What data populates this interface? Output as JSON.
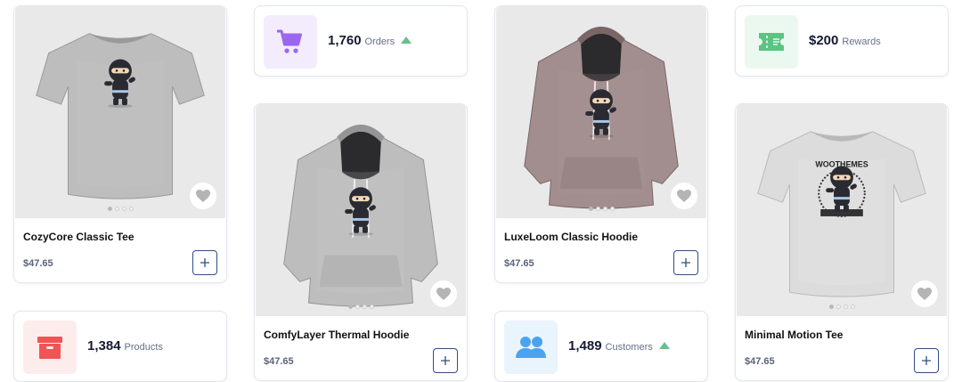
{
  "products": [
    {
      "name": "CozyCore Classic Tee",
      "price": "$47.65",
      "type": "tee",
      "color": "#bdbdbd",
      "dots": 4
    },
    {
      "name": "ComfyLayer Thermal Hoodie",
      "price": "$47.65",
      "type": "hoodie",
      "color": "#bdbdbd",
      "dots": 4
    },
    {
      "name": "LuxeLoom Classic Hoodie",
      "price": "$47.65",
      "type": "hoodie",
      "color": "#a28e8e",
      "dots": 4
    },
    {
      "name": "Minimal Motion Tee",
      "price": "$47.65",
      "type": "tee",
      "color": "#dcdcdc",
      "print_text": "WOOTHEMES",
      "dots": 4
    }
  ],
  "stats": {
    "orders": {
      "value": "1,760",
      "label": "Orders",
      "icon": "cart-icon",
      "icon_color": "#9b66f0",
      "icon_bg": "#f2ecfd",
      "trend": "up"
    },
    "rewards": {
      "value": "$200",
      "label": "Rewards",
      "icon": "ticket-icon",
      "icon_color": "#5bc383",
      "icon_bg": "#ebf8ef"
    },
    "products": {
      "value": "1,384",
      "label": "Products",
      "icon": "box-icon",
      "icon_color": "#f05454",
      "icon_bg": "#fdecec"
    },
    "customers": {
      "value": "1,489",
      "label": "Customers",
      "icon": "users-icon",
      "icon_color": "#4aa3ee",
      "icon_bg": "#eaf4fd",
      "trend": "up"
    }
  },
  "icons": {
    "wishlist": "heart-icon",
    "add": "plus-icon"
  }
}
